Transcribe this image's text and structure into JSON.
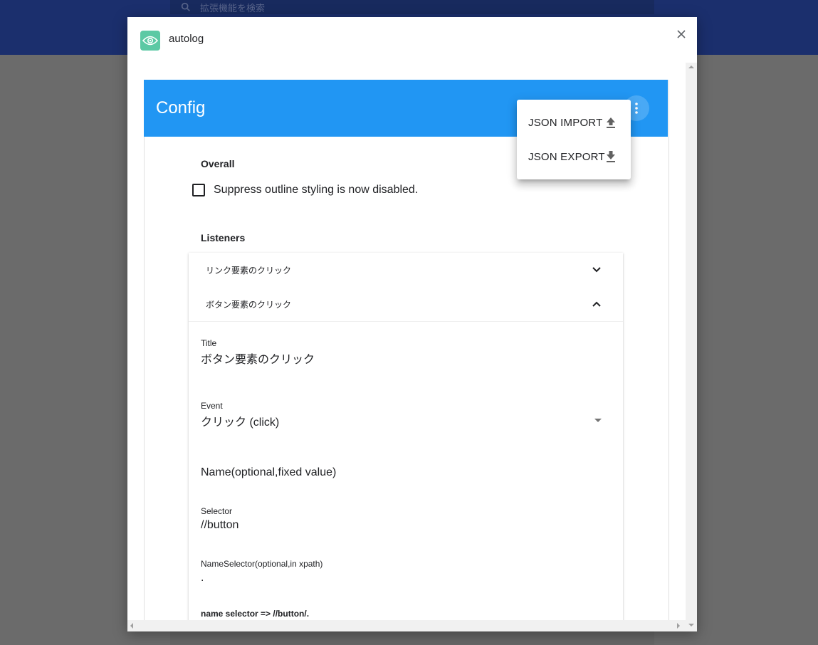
{
  "background": {
    "search_placeholder": "拡張機能を検索"
  },
  "dialog": {
    "extension_name": "autolog",
    "extension_icon": "eye-icon",
    "close_icon": "close-icon"
  },
  "config": {
    "title": "Config",
    "more_icon": "more-vert-icon",
    "overall_label": "Overall",
    "suppress_checkbox": {
      "label": "Suppress outline styling is now disabled.",
      "checked": false
    },
    "listeners_label": "Listeners",
    "panels": [
      {
        "title": "リンク要素のクリック",
        "expanded": false
      },
      {
        "title": "ボタン要素のクリック",
        "expanded": true
      }
    ],
    "expanded_panel": {
      "title_label": "Title",
      "title_value": "ボタン要素のクリック",
      "event_label": "Event",
      "event_value": "クリック (click)",
      "name_placeholder": "Name(optional,fixed value)",
      "selector_label": "Selector",
      "selector_value": "//button",
      "name_selector_label": "NameSelector(optional,in xpath)",
      "name_selector_value": ".",
      "hint": "name selector => //button/."
    }
  },
  "menu": {
    "items": [
      {
        "label": "JSON IMPORT",
        "icon": "upload-icon"
      },
      {
        "label": "JSON EXPORT",
        "icon": "download-icon"
      }
    ]
  },
  "colors": {
    "toolbar": "#2196f3",
    "topbar": "#1b2f6d",
    "extension_icon_bg": "#5cc9a4"
  }
}
